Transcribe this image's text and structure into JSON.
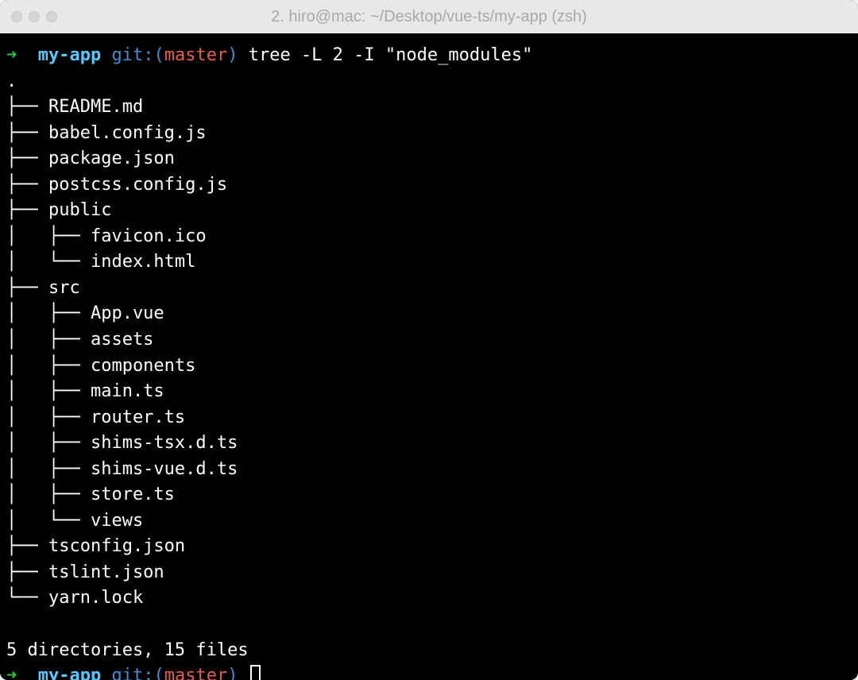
{
  "window": {
    "title": "2. hiro@mac: ~/Desktop/vue-ts/my-app (zsh)"
  },
  "prompt1": {
    "arrow": "➜",
    "dir": "my-app",
    "git_label": "git:",
    "paren_open": "(",
    "branch": "master",
    "paren_close": ")",
    "command": "tree -L 2 -I \"node_modules\""
  },
  "tree": {
    "root": ".",
    "lines": [
      "├── README.md",
      "├── babel.config.js",
      "├── package.json",
      "├── postcss.config.js",
      "├── public",
      "│   ├── favicon.ico",
      "│   └── index.html",
      "├── src",
      "│   ├── App.vue",
      "│   ├── assets",
      "│   ├── components",
      "│   ├── main.ts",
      "│   ├── router.ts",
      "│   ├── shims-tsx.d.ts",
      "│   ├── shims-vue.d.ts",
      "│   ├── store.ts",
      "│   └── views",
      "├── tsconfig.json",
      "├── tslint.json",
      "└── yarn.lock"
    ],
    "summary": "5 directories, 15 files"
  },
  "prompt2": {
    "arrow": "➜",
    "dir": "my-app",
    "git_label": "git:",
    "paren_open": "(",
    "branch": "master",
    "paren_close": ")"
  }
}
